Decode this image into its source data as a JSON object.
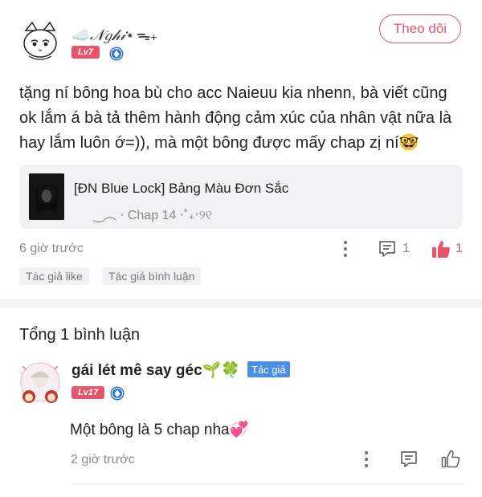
{
  "post": {
    "author": "☁️𝒩𝑔𝒽𝒾⋆ᯓ₊",
    "level": "Lv7",
    "follow_label": "Theo dõi",
    "content": "tặng ní bông hoa bù cho acc Naieuu kia nhenn, bà viết cũng ok lắm á bà tả thêm hành động cảm xúc của nhân vật nữa là hay lắm luôn ớ=)), mà một bông được mấy chap zị ní🤓",
    "book": {
      "title": "[ĐN Blue Lock] Bảng Màu Đơn Sắc",
      "chapter": "‿︵ ⋅ Chap 14 ⋅˚₊‧୨୧"
    },
    "time": "6 giờ trước",
    "comment_count": "1",
    "like_count": "1",
    "tags": [
      "Tác giả like",
      "Tác giả bình luận"
    ]
  },
  "comments": {
    "total_label": "Tổng 1 bình luận",
    "items": [
      {
        "author": "gái lét mê say géc🌱🍀",
        "author_badge": "Tác giả",
        "level": "Lv17",
        "text": "Một bông là 5 chap nha💞",
        "time": "2 giờ trước"
      }
    ]
  },
  "colors": {
    "accent": "#e8546a",
    "author_badge": "#4a90e2",
    "muted": "#8a8a8a"
  }
}
